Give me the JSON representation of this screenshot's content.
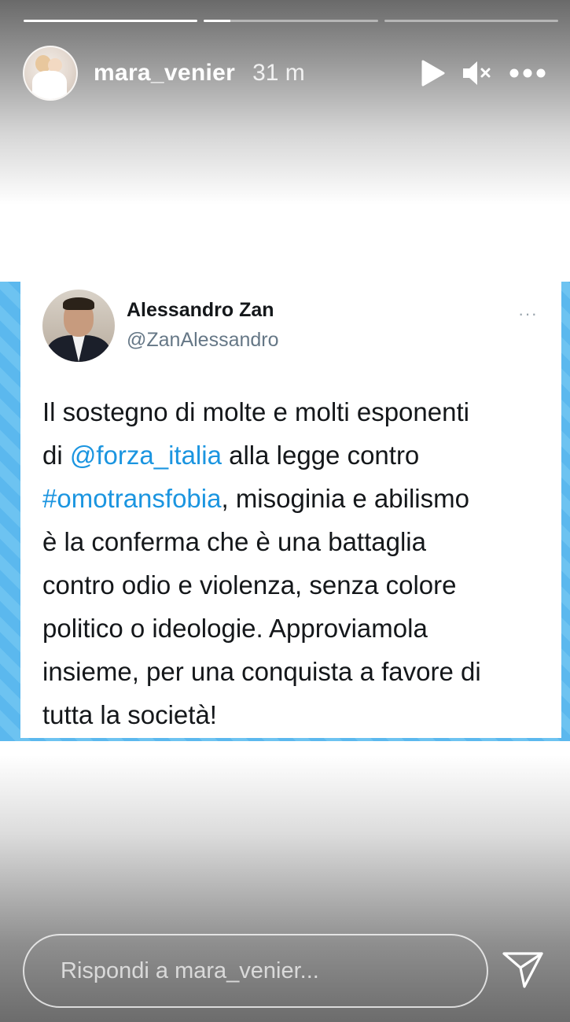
{
  "story": {
    "progress": [
      1.0,
      0.15,
      0.0
    ],
    "username": "mara_venier",
    "time_ago": "31 m",
    "icons": {
      "play": "play-icon",
      "mute": "speaker-muted-icon",
      "more": "more-options-icon"
    }
  },
  "tweet": {
    "author_name": "Alessandro Zan",
    "author_handle": "@ZanAlessandro",
    "more_symbol": "···",
    "lines": [
      {
        "parts": [
          {
            "text": "Il sostegno di molte e molti esponenti",
            "link": false
          }
        ]
      },
      {
        "parts": [
          {
            "text": "di ",
            "link": false
          },
          {
            "text": "@forza_italia",
            "link": true
          },
          {
            "text": " alla legge contro",
            "link": false
          }
        ]
      },
      {
        "parts": [
          {
            "text": "#omotransfobia",
            "link": true
          },
          {
            "text": ", misoginia e abilismo",
            "link": false
          }
        ]
      },
      {
        "parts": [
          {
            "text": "è la conferma che è una battaglia",
            "link": false
          }
        ]
      },
      {
        "parts": [
          {
            "text": "contro odio e violenza, senza colore",
            "link": false
          }
        ]
      },
      {
        "parts": [
          {
            "text": "politico o ideologie. Approviamola",
            "link": false
          }
        ]
      },
      {
        "parts": [
          {
            "text": "insieme, per una conquista a favore di",
            "link": false
          }
        ]
      },
      {
        "parts": [
          {
            "text": "tutta la società!",
            "link": false
          }
        ]
      }
    ],
    "colors": {
      "link": "#1b95e0",
      "text": "#14171a",
      "frame": "#5bb8ee"
    }
  },
  "reply": {
    "placeholder": "Rispondi a mara_venier..."
  }
}
